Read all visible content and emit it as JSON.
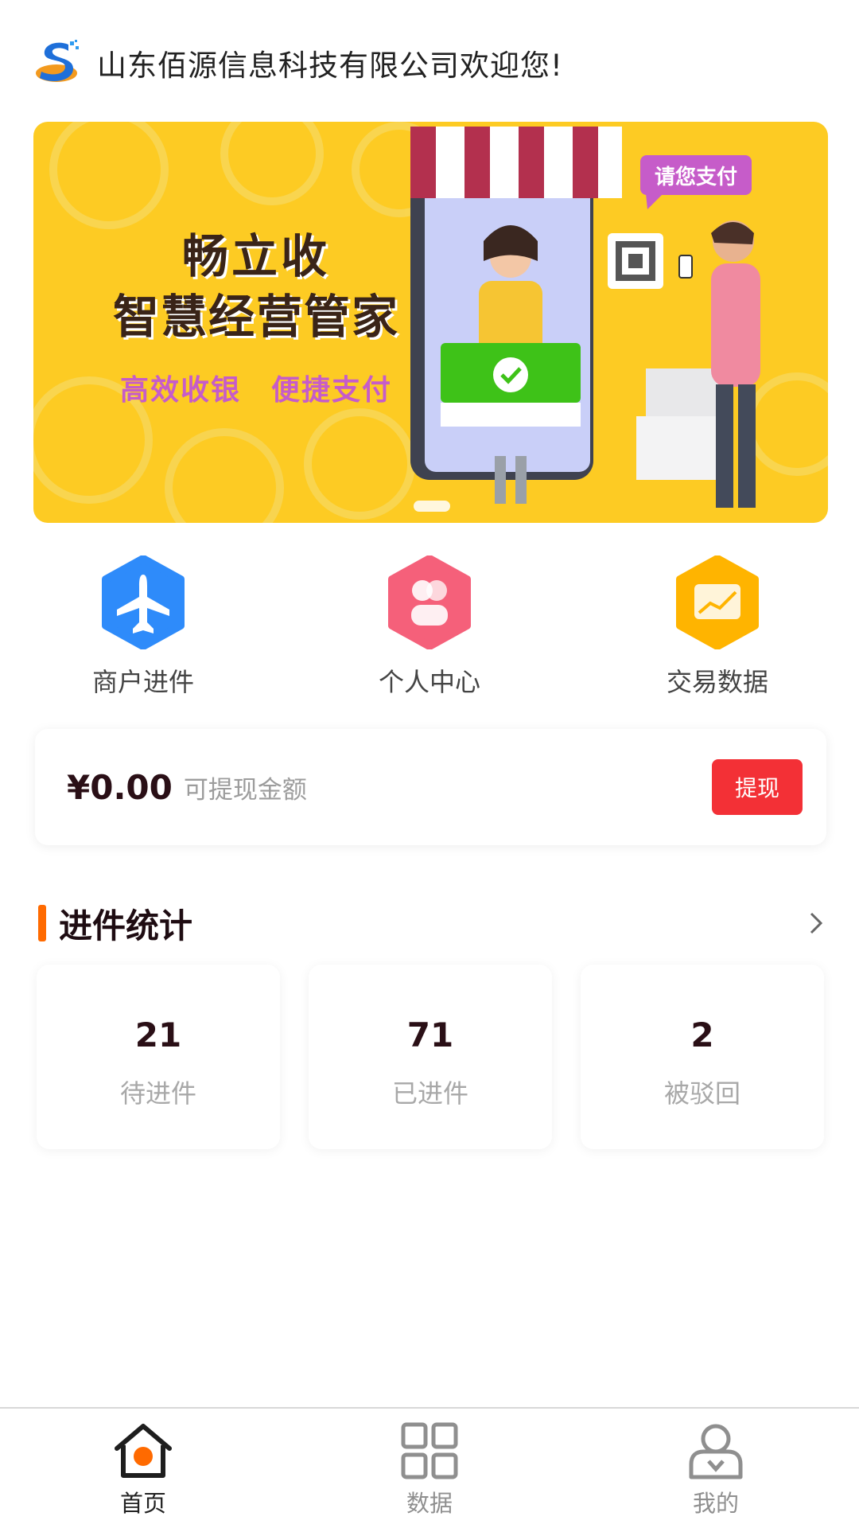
{
  "header": {
    "welcome": "山东佰源信息科技有限公司欢迎您!",
    "logo_icon": "company-s-logo"
  },
  "banner": {
    "title_line1": "畅立收",
    "title_line2": "智慧经营管家",
    "subtitle": "高效收银　便捷支付",
    "bubble": "请您支付",
    "background_color": "#FDCB23"
  },
  "menu": [
    {
      "label": "商户进件",
      "icon": "airplane-icon",
      "color": "#2E8BFA"
    },
    {
      "label": "个人中心",
      "icon": "person-icon",
      "color": "#F5607A"
    },
    {
      "label": "交易数据",
      "icon": "chart-icon",
      "color": "#FFB400"
    }
  ],
  "balance": {
    "amount": "¥0.00",
    "label": "可提现金额",
    "button": "提现"
  },
  "stats_section": {
    "title": "进件统计",
    "items": [
      {
        "value": "21",
        "label": "待进件"
      },
      {
        "value": "71",
        "label": "已进件"
      },
      {
        "value": "2",
        "label": "被驳回"
      }
    ]
  },
  "tabbar": {
    "items": [
      {
        "label": "首页",
        "icon": "home-icon",
        "active": true
      },
      {
        "label": "数据",
        "icon": "grid-icon",
        "active": false
      },
      {
        "label": "我的",
        "icon": "user-icon",
        "active": false
      }
    ]
  },
  "colors": {
    "accent": "#FF6A00",
    "withdraw_button": "#F33036"
  }
}
